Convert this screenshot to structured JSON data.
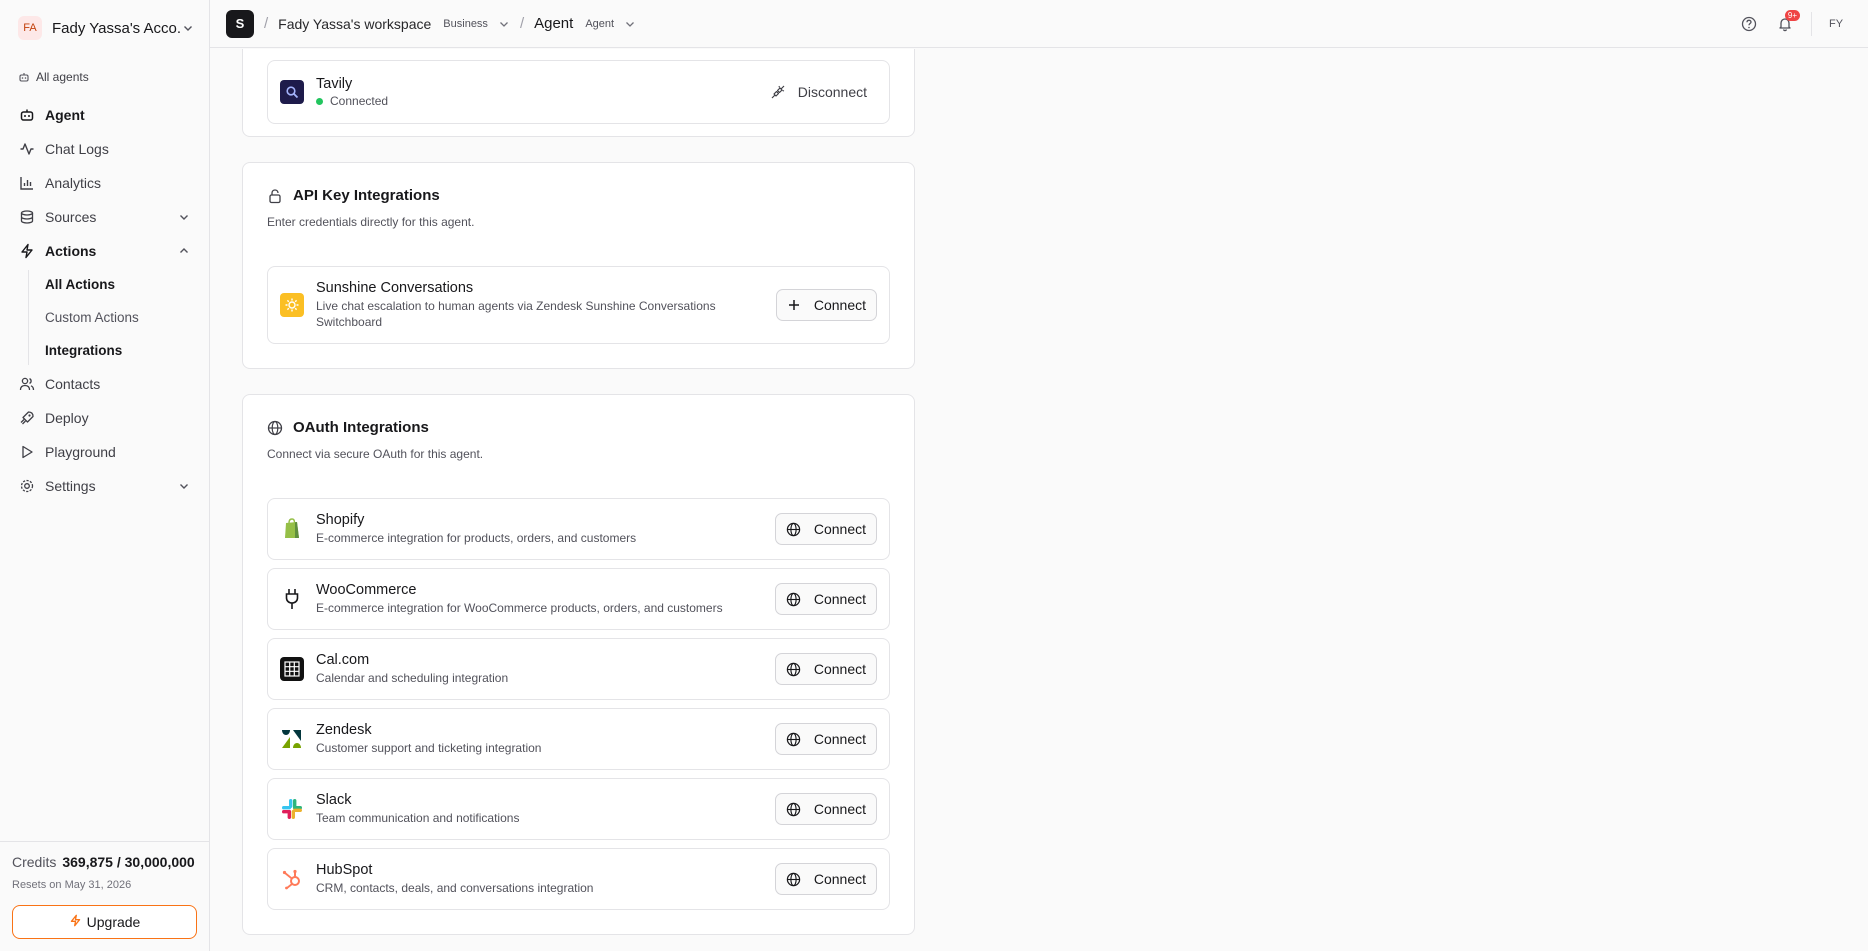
{
  "account": {
    "initials": "FA",
    "name": "Fady Yassa's Acco..."
  },
  "nav": {
    "all_agents": "All agents",
    "items": [
      {
        "label": "Agent"
      },
      {
        "label": "Chat Logs"
      },
      {
        "label": "Analytics"
      },
      {
        "label": "Sources"
      },
      {
        "label": "Actions"
      },
      {
        "label": "Contacts"
      },
      {
        "label": "Deploy"
      },
      {
        "label": "Playground"
      },
      {
        "label": "Settings"
      }
    ],
    "actions_sub": [
      {
        "label": "All Actions"
      },
      {
        "label": "Custom Actions"
      },
      {
        "label": "Integrations"
      }
    ]
  },
  "credits": {
    "label": "Credits",
    "value": "369,875 / 30,000,000",
    "resets": "Resets on May 31, 2026",
    "upgrade": "Upgrade"
  },
  "topbar": {
    "workspace_initial": "S",
    "workspace": "Fady Yassa's workspace",
    "plan": "Business",
    "agent": "Agent",
    "agent_pill": "Agent",
    "notifications_badge": "9+",
    "user_initials": "FY"
  },
  "tavily": {
    "name": "Tavily",
    "status": "Connected",
    "action": "Disconnect"
  },
  "api_section": {
    "title": "API Key Integrations",
    "subtitle": "Enter credentials directly for this agent.",
    "items": [
      {
        "name": "Sunshine Conversations",
        "desc": "Live chat escalation to human agents via Zendesk Sunshine Conversations Switchboard",
        "action": "Connect"
      }
    ]
  },
  "oauth_section": {
    "title": "OAuth Integrations",
    "subtitle": "Connect via secure OAuth for this agent.",
    "items": [
      {
        "name": "Shopify",
        "desc": "E-commerce integration for products, orders, and customers",
        "action": "Connect"
      },
      {
        "name": "WooCommerce",
        "desc": "E-commerce integration for WooCommerce products, orders, and customers",
        "action": "Connect"
      },
      {
        "name": "Cal.com",
        "desc": "Calendar and scheduling integration",
        "action": "Connect"
      },
      {
        "name": "Zendesk",
        "desc": "Customer support and ticketing integration",
        "action": "Connect"
      },
      {
        "name": "Slack",
        "desc": "Team communication and notifications",
        "action": "Connect"
      },
      {
        "name": "HubSpot",
        "desc": "CRM, contacts, deals, and conversations integration",
        "action": "Connect"
      }
    ]
  },
  "icons": {
    "tavily": "magnifier-logo",
    "sunshine": "sun-logo",
    "shopify": "shopping-bag-logo",
    "woocommerce": "plug-logo",
    "calcom": "calendar-grid-logo",
    "zendesk": "zendesk-logo",
    "slack": "slack-logo",
    "hubspot": "hubspot-logo"
  },
  "colors": {
    "accent_orange": "#f97316",
    "connected_green": "#22c55e",
    "sunshine_yellow": "#fbbf24",
    "tavily_navy": "#1e1b4b",
    "shopify_green": "#95bf47",
    "hubspot_orange": "#ff7a59"
  }
}
